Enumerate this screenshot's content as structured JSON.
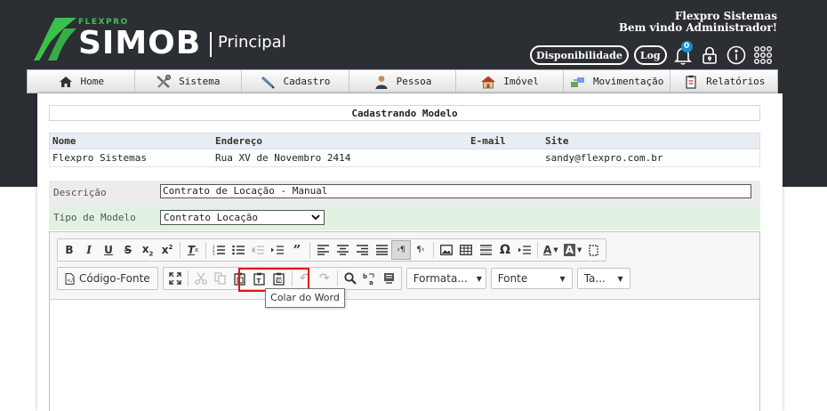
{
  "header": {
    "logo_small": "FLEXPRO",
    "logo_main": "SIMOB",
    "logo_section": "Principal",
    "company": "Flexpro Sistemas",
    "welcome": "Bem vindo Administrador!",
    "buttons": {
      "availability": "Disponibilidade",
      "log": "Log"
    },
    "notification_count": "0",
    "icons": [
      "bell-icon",
      "lock-icon",
      "info-icon",
      "apps-grid-icon"
    ]
  },
  "nav": {
    "items": [
      {
        "label": "Home",
        "icon": "home-icon"
      },
      {
        "label": "Sistema",
        "icon": "tools-icon"
      },
      {
        "label": "Cadastro",
        "icon": "pen-icon"
      },
      {
        "label": "Pessoa",
        "icon": "person-icon"
      },
      {
        "label": "Imóvel",
        "icon": "house-icon"
      },
      {
        "label": "Movimentação",
        "icon": "transfer-icon"
      },
      {
        "label": "Relatórios",
        "icon": "clipboard-icon"
      }
    ]
  },
  "page": {
    "title": "Cadastrando Modelo",
    "info": {
      "headers": [
        "Nome",
        "Endereço",
        "E-mail",
        "Site"
      ],
      "row": [
        "Flexpro Sistemas",
        "Rua XV de Novembro 2414",
        "",
        "sandy@flexpro.com.br"
      ]
    },
    "form": {
      "description_label": "Descrição",
      "description_value": "Contrato de Locação - Manual",
      "type_label": "Tipo de Modelo",
      "type_value": "Contrato Locação"
    }
  },
  "editor": {
    "source_button": "Código-Fonte",
    "combo_format": "Formata...",
    "combo_font": "Fonte",
    "combo_size": "Ta...",
    "tooltip": "Colar do Word"
  },
  "colors": {
    "header_bg": "#2b2f33",
    "logo_green": "#39c24b",
    "highlight": "#e01515",
    "badge": "#1b8ad8"
  }
}
